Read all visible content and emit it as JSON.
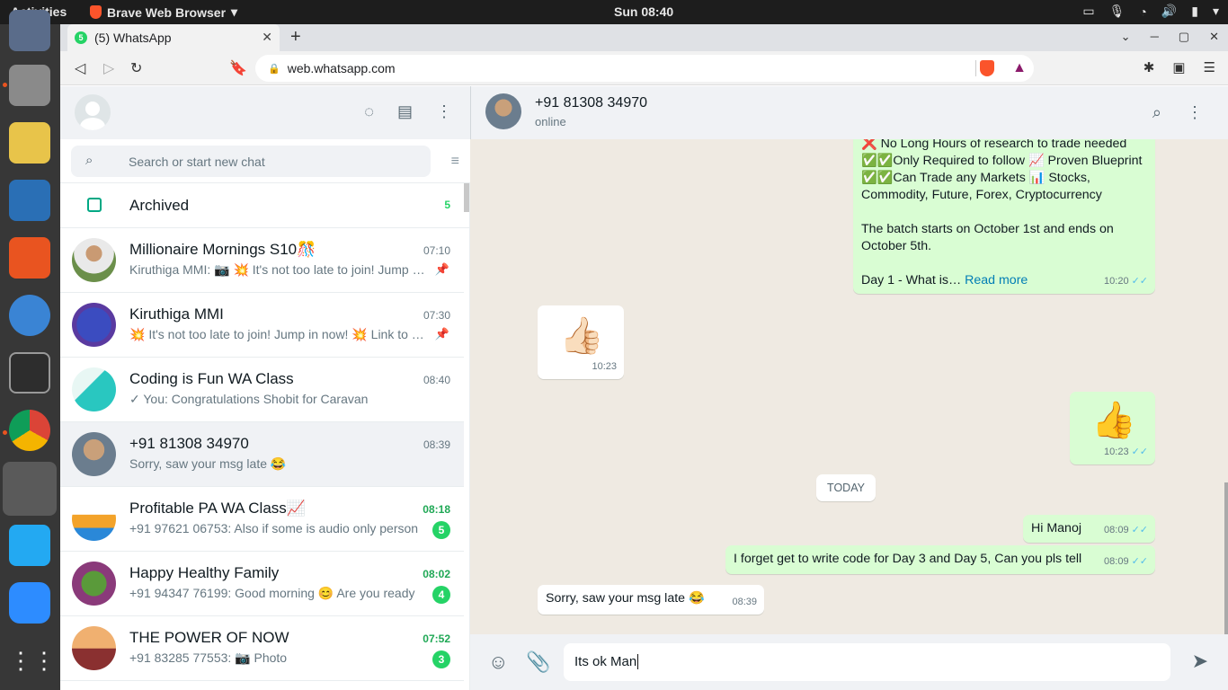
{
  "topbar": {
    "activities": "Activities",
    "app": "Brave Web Browser",
    "clock": "Sun 08:40"
  },
  "browser": {
    "tab_title": "(5) WhatsApp",
    "tab_badge": "5",
    "url": "web.whatsapp.com"
  },
  "left": {
    "search_placeholder": "Search or start new chat",
    "archived_label": "Archived",
    "archived_count": "5",
    "chats": [
      {
        "name": "Millionaire Mornings S10🎊",
        "time": "07:10",
        "msg": "Kiruthiga MMI: 📷 💥 It's not too late to join! Jump in now!",
        "time_green": false,
        "badge": "",
        "pinned": true
      },
      {
        "name": "Kiruthiga MMI",
        "time": "07:30",
        "msg": "💥 It's not too late to join! Jump in now! 💥 Link to join",
        "time_green": false,
        "badge": "",
        "pinned": true
      },
      {
        "name": "Coding is Fun WA Class",
        "time": "08:40",
        "msg": "✓ You: Congratulations Shobit for Caravan",
        "time_green": false,
        "badge": "",
        "pinned": false
      },
      {
        "name": "+91 81308 34970",
        "time": "08:39",
        "msg": "Sorry, saw your msg late 😂",
        "time_green": false,
        "badge": "",
        "pinned": false
      },
      {
        "name": "Profitable PA WA Class📈",
        "time": "08:18",
        "msg": "+91 97621 06753: Also if some is audio only person",
        "time_green": true,
        "badge": "5",
        "pinned": false
      },
      {
        "name": "Happy Healthy Family",
        "time": "08:02",
        "msg": "+91 94347 76199: Good morning 😊 Are you ready",
        "time_green": true,
        "badge": "4",
        "pinned": false
      },
      {
        "name": "THE POWER OF NOW",
        "time": "07:52",
        "msg": "+91 83285 77553: 📷 Photo",
        "time_green": true,
        "badge": "3",
        "pinned": false
      }
    ]
  },
  "right": {
    "contact_name": "+91 81308 34970",
    "contact_status": "online",
    "m1_line0": "❌ No Long Hours of research to trade needed",
    "m1_line1": "✅✅Only Required to follow 📈 Proven Blueprint",
    "m1_line2": "✅✅Can Trade any Markets 📊  Stocks,",
    "m1_line3": "Commodity, Future, Forex, Cryptocurrency",
    "m1_line4": "The batch starts on October 1st  and ends on",
    "m1_line5": "October 5th.",
    "m1_line6": "Day 1 - What is…",
    "m1_more": "Read more",
    "m1_time": "10:20",
    "m2_emoji": "👍🏻",
    "m2_time": "10:23",
    "m3_emoji": "👍",
    "m3_time": "10:23",
    "today": "TODAY",
    "m4_text": "Hi Manoj",
    "m4_time": "08:09",
    "m5_text": "I forget get to write code for Day 3 and Day 5, Can you pls tell",
    "m5_time": "08:09",
    "m6_text": "Sorry, saw your msg late 😂",
    "m6_time": "08:39",
    "composer_value": "Its ok Man"
  }
}
